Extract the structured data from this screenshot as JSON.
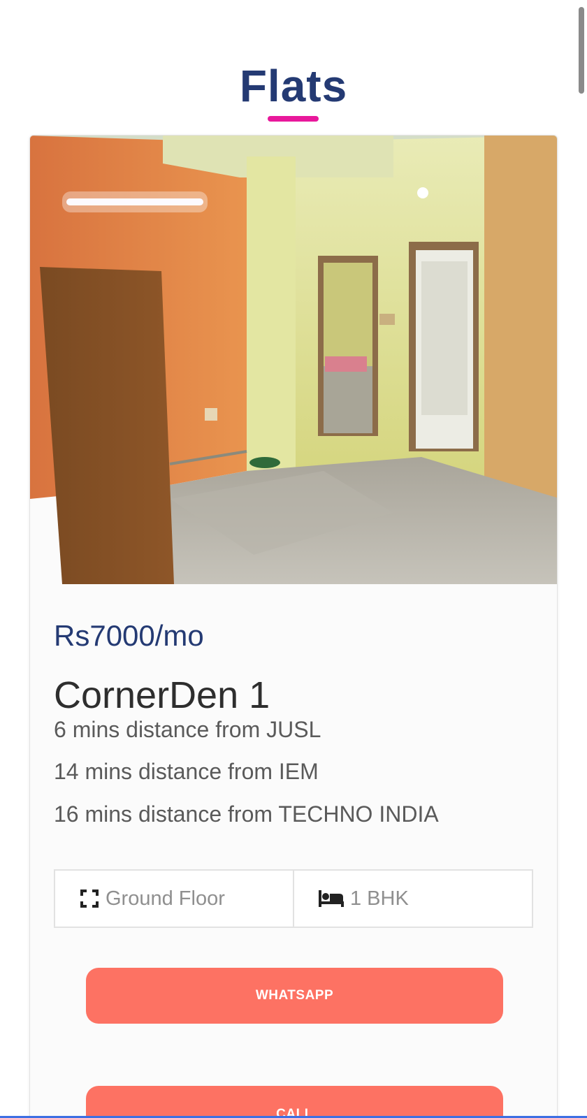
{
  "page": {
    "title": "Flats"
  },
  "listing": {
    "price": "Rs7000/mo",
    "name": "CornerDen 1",
    "distances": [
      "6 mins distance from JUSL",
      "14 mins distance from IEM",
      "16 mins distance from TECHNO INDIA"
    ],
    "features": {
      "floor": {
        "label": "Ground Floor",
        "icon": "expand-icon"
      },
      "bhk": {
        "label": "1 BHK",
        "icon": "bed-icon"
      }
    }
  },
  "actions": {
    "whatsapp_label": "WHATSAPP",
    "call_label": "CALL"
  },
  "colors": {
    "title": "#243a73",
    "accent_underline": "#e8189b",
    "button": "#fd7263"
  }
}
